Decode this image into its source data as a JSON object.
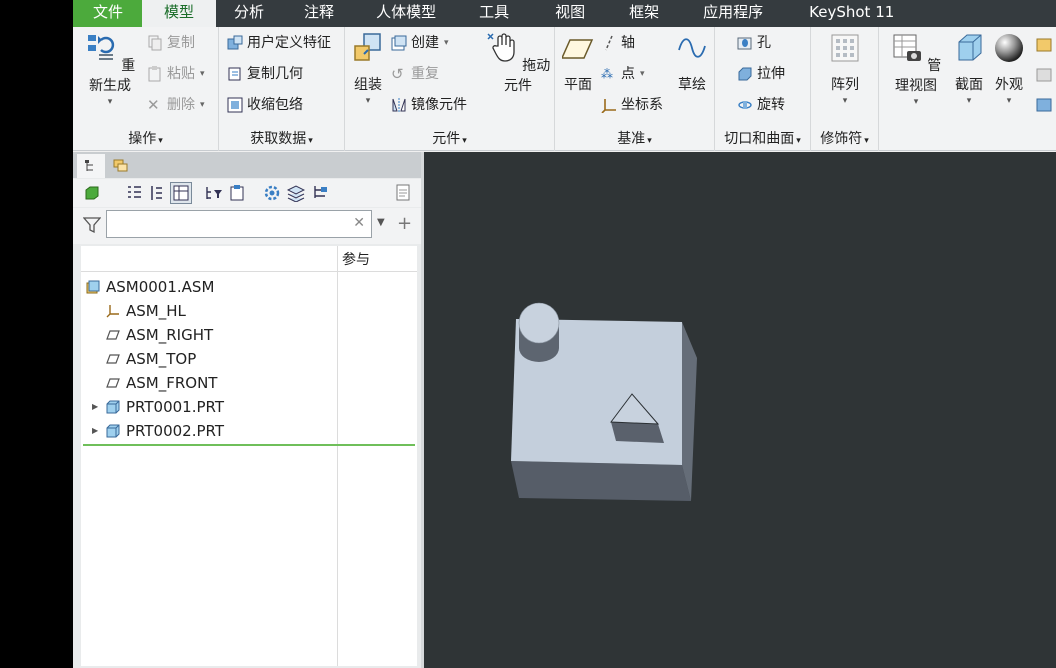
{
  "menu": {
    "tabs": [
      "文件",
      "模型",
      "分析",
      "注释",
      "人体模型",
      "工具",
      "视图",
      "框架",
      "应用程序",
      "KeyShot 11"
    ],
    "active_index": 1
  },
  "ribbon": {
    "ops": {
      "regenerate": "重新生成",
      "copy": "复制",
      "paste": "粘贴",
      "delete": "删除",
      "label": "操作"
    },
    "getdata": {
      "udf": "用户定义特征",
      "copygeom": "复制几何",
      "shrinkwrap": "收缩包络",
      "label": "获取数据"
    },
    "component": {
      "assemble": "组装",
      "create": "创建",
      "repeat": "重复",
      "mirror": "镜像元件",
      "drag": "拖动元件",
      "label": "元件"
    },
    "datum": {
      "plane": "平面",
      "axis": "轴",
      "point": "点",
      "csys": "坐标系",
      "sketch": "草绘",
      "label": "基准"
    },
    "cut": {
      "hole": "孔",
      "extrude": "拉伸",
      "revolve": "旋转",
      "label": "切口和曲面"
    },
    "modifier": {
      "pattern": "阵列",
      "label": "修饰符"
    },
    "view": {
      "manage": "管理视图",
      "section": "截面",
      "appearance": "外观"
    }
  },
  "panel": {
    "filter_placeholder": "",
    "column_header": "参与",
    "tree": [
      {
        "label": "ASM0001.ASM",
        "icon": "assembly-icon"
      },
      {
        "label": "ASM_HL",
        "icon": "csys-icon"
      },
      {
        "label": "ASM_RIGHT",
        "icon": "datum-plane-icon"
      },
      {
        "label": "ASM_TOP",
        "icon": "datum-plane-icon"
      },
      {
        "label": "ASM_FRONT",
        "icon": "datum-plane-icon"
      },
      {
        "label": "PRT0001.PRT",
        "icon": "part-icon"
      },
      {
        "label": "PRT0002.PRT",
        "icon": "part-icon"
      }
    ]
  },
  "colors": {
    "menubar": "#353b3f",
    "file_tab": "#4caa3c",
    "viewport_bg": "#2f3436",
    "model_top": "#c4cfdc",
    "model_side": "#5c6470"
  }
}
